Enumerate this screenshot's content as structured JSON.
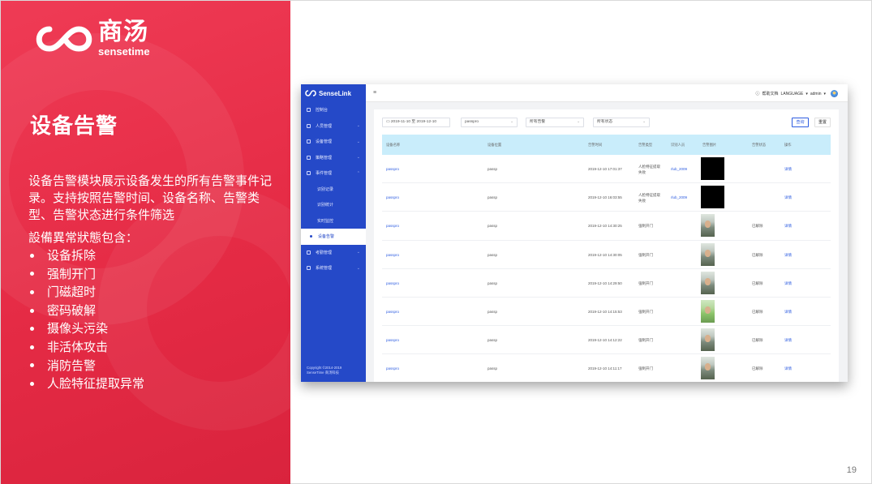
{
  "brand": {
    "cn": "商汤",
    "en": "sensetime"
  },
  "slide": {
    "title": "设备告警",
    "description": "设备告警模块展示设备发生的所有告警事件记录。支持按照告警时间、设备名称、告警类型、告警状态进行条件筛选",
    "subhead": "設備異常狀態包含：",
    "bullets": [
      "设备拆除",
      "强制开门",
      "门磁超时",
      "密码破解",
      "摄像头污染",
      "非活体攻击",
      "消防告警",
      "人脸特征提取异常"
    ],
    "page_number": "19"
  },
  "app": {
    "brand": "SenseLink",
    "nav": [
      {
        "label": "控制台"
      },
      {
        "label": "人员管理"
      },
      {
        "label": "设备管理"
      },
      {
        "label": "策略管理"
      },
      {
        "label": "事件管理"
      },
      {
        "label": "识别记录"
      },
      {
        "label": "识别统计"
      },
      {
        "label": "实时监控"
      },
      {
        "label": "设备告警"
      },
      {
        "label": "考勤管理"
      },
      {
        "label": "系统管理"
      }
    ],
    "copyright_line1": "Copyright ©2014-2019",
    "copyright_line2": "SenseTime 商汤科技",
    "topbar": {
      "help": "帮助文档",
      "language": "LANGUAGE",
      "user": "admin"
    },
    "filters": {
      "date_range": "2019-11-10  至  2019-12-10",
      "device": "passpro",
      "alarm_type": "所有告警",
      "alarm_status": "所有状态",
      "query_label": "查询",
      "reset_label": "重置"
    },
    "columns": [
      "设备名称",
      "设备位置",
      "告警时间",
      "告警类型",
      "识别人员",
      "告警图片",
      "告警状态",
      "操作"
    ],
    "rows": [
      {
        "device": "passpro",
        "location": "passp",
        "time": "2019-12-10 17:01:37",
        "type_l1": "人脸特征提取",
        "type_l2": "失败",
        "person": "rlub_2009",
        "status": "",
        "action": "详情",
        "photo": "black"
      },
      {
        "device": "passpro",
        "location": "passp",
        "time": "2019-12-10 16:03:55",
        "type_l1": "人脸特征提取",
        "type_l2": "失败",
        "person": "rlub_2009",
        "status": "",
        "action": "详情",
        "photo": "black"
      },
      {
        "device": "passpro",
        "location": "passp",
        "time": "2019-12-10 14:30:25",
        "type_l1": "强制开门",
        "type_l2": "",
        "person": "",
        "status": "已解除",
        "action": "详情",
        "photo": "face"
      },
      {
        "device": "passpro",
        "location": "passp",
        "time": "2019-12-10 14:30:05",
        "type_l1": "强制开门",
        "type_l2": "",
        "person": "",
        "status": "已解除",
        "action": "详情",
        "photo": "face"
      },
      {
        "device": "passpro",
        "location": "passp",
        "time": "2019-12-10 14:29:50",
        "type_l1": "强制开门",
        "type_l2": "",
        "person": "",
        "status": "已解除",
        "action": "详情",
        "photo": "face"
      },
      {
        "device": "passpro",
        "location": "passp",
        "time": "2019-12-10 14:15:53",
        "type_l1": "强制开门",
        "type_l2": "",
        "person": "",
        "status": "已解除",
        "action": "详情",
        "photo": "green"
      },
      {
        "device": "passpro",
        "location": "passp",
        "time": "2019-12-10 14:12:22",
        "type_l1": "强制开门",
        "type_l2": "",
        "person": "",
        "status": "已解除",
        "action": "详情",
        "photo": "face"
      },
      {
        "device": "passpro",
        "location": "passp",
        "time": "2019-12-10 14:11:17",
        "type_l1": "强制开门",
        "type_l2": "",
        "person": "",
        "status": "已解除",
        "action": "详情",
        "photo": "face"
      }
    ]
  },
  "colors": {
    "accent_red": "#e52b45",
    "sidebar_blue": "#2549c8",
    "link_blue": "#2d5ce0",
    "header_cyan": "#c9edfb"
  }
}
